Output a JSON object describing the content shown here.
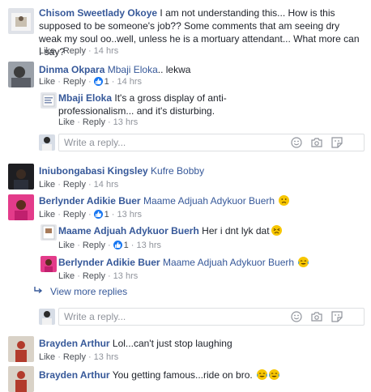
{
  "comments": [
    {
      "author": "Chisom Sweetlady Okoye",
      "text": " I am not understanding this... How is this supposed to be someone's job?? Some comments that am seeing dry weak my soul oo..well, unless he is a mortuary attendant... What more can I say?",
      "like": "Like",
      "reply": "Reply",
      "time": "14 hrs"
    },
    {
      "author": "Dinma Okpara",
      "mention": "Mbaji Eloka",
      "text": ".. lekwa",
      "like": "Like",
      "reply": "Reply",
      "reaction_count": "1",
      "time": "14 hrs",
      "replies": [
        {
          "author": "Mbaji Eloka",
          "text": "It's a gross display of anti-professionalism... and it's disturbing.",
          "like": "Like",
          "reply": "Reply",
          "time": "13 hrs"
        }
      ]
    },
    {
      "author": "Iniubongabasi Kingsley",
      "mention": "Kufre Bobby",
      "like": "Like",
      "reply": "Reply",
      "time": "14 hrs"
    },
    {
      "author": "Berlynder Adikie Buer",
      "mention": "Maame Adjuah Adykuor Buerh",
      "like": "Like",
      "reply": "Reply",
      "reaction_count": "1",
      "time": "13 hrs",
      "replies": [
        {
          "author": "Maame Adjuah Adykuor Buerh",
          "text": "Her i dnt lyk dat",
          "like": "Like",
          "reply": "Reply",
          "reaction_count": "1",
          "time": "13 hrs"
        },
        {
          "author": "Berlynder Adikie Buer",
          "mention": "Maame Adjuah Adykuor Buerh",
          "like": "Like",
          "reply": "Reply",
          "time": "13 hrs"
        }
      ],
      "view_more": "View more replies"
    },
    {
      "author": "Brayden Arthur",
      "text": "Lol...can't just stop laughing",
      "like": "Like",
      "reply": "Reply",
      "time": "13 hrs"
    },
    {
      "author": "Brayden Arthur",
      "text": "You getting famous...ride on bro."
    }
  ],
  "reply_placeholder": "Write a reply...",
  "icons": {
    "reaction": "like-icon",
    "emoji": "smiley-icon",
    "camera": "camera-icon",
    "sticker": "sticker-icon"
  },
  "colors": {
    "name": "#365899",
    "meta": "#90949c",
    "accent": "#1877f2"
  }
}
